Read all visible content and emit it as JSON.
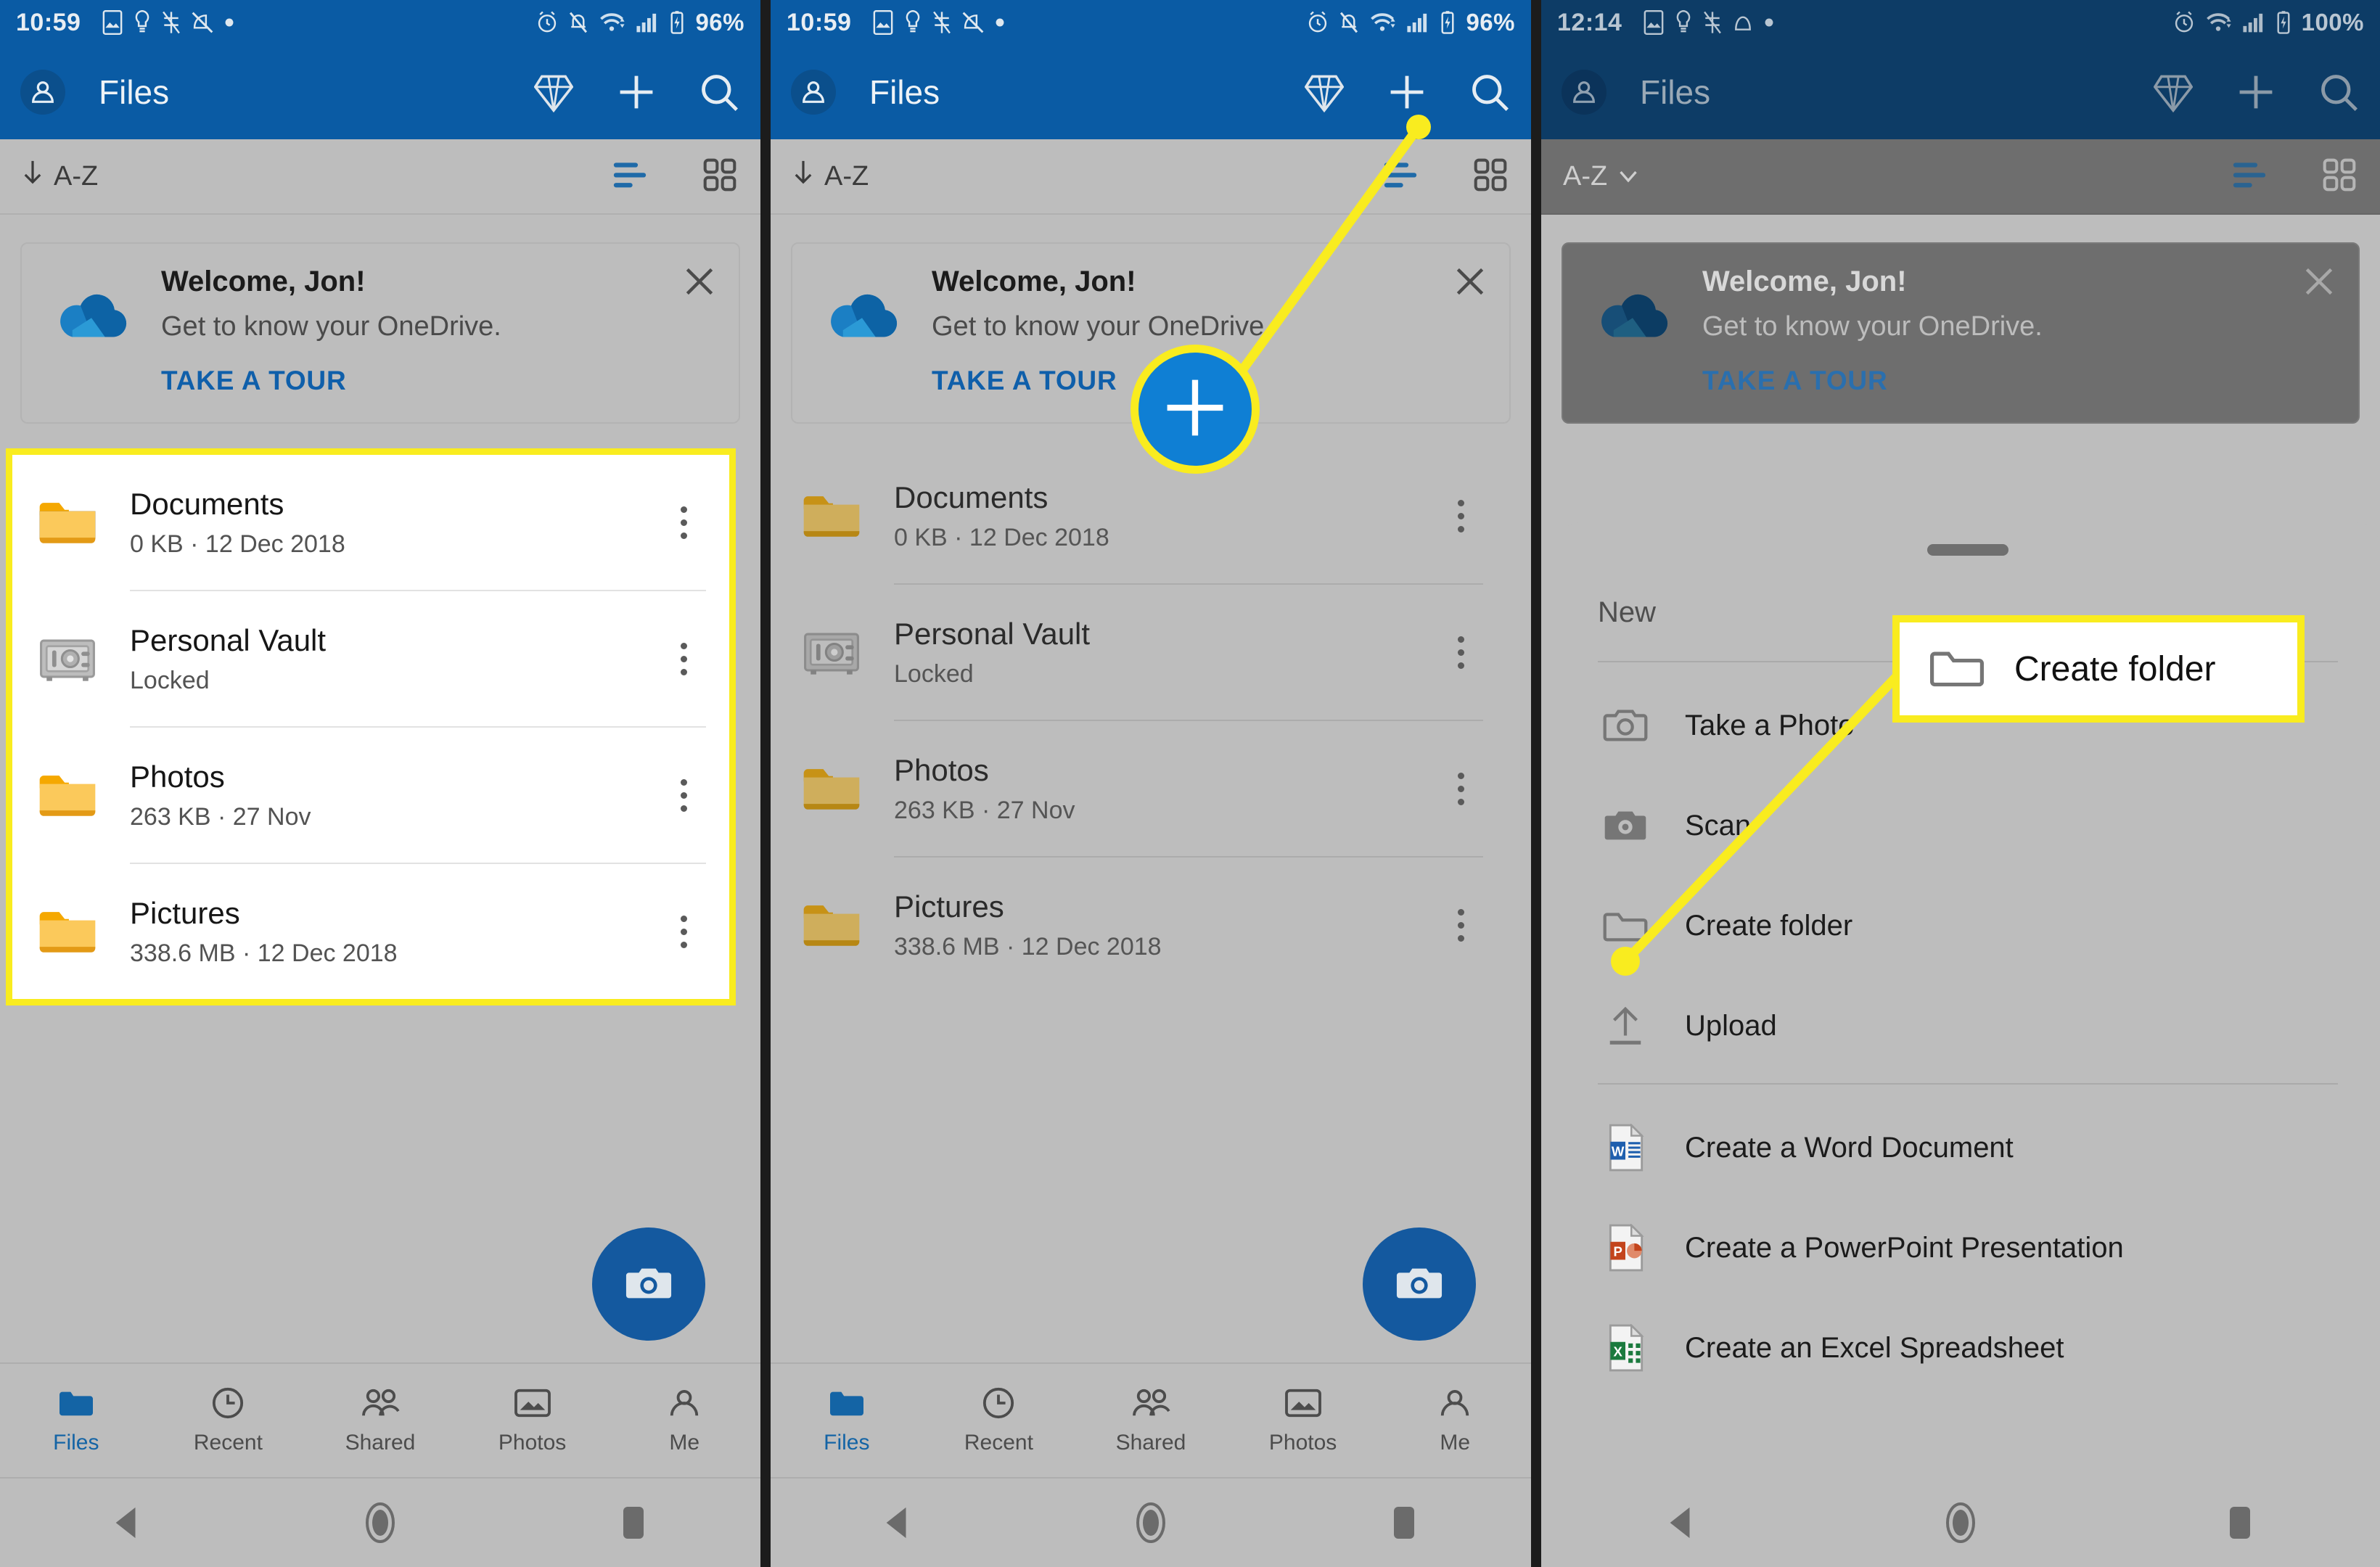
{
  "panels": [
    {
      "status": {
        "time": "10:59",
        "battery": "96%"
      },
      "appbar": {
        "title": "Files",
        "avatar_icon": "account-circle-icon",
        "premium_icon": "diamond-icon",
        "add_icon": "plus-icon",
        "search_icon": "search-icon"
      },
      "sortbar": {
        "sort_label": "A-Z",
        "sort_icon": "arrow-down-icon",
        "list_view_icon": "list-view-icon",
        "grid_view_icon": "grid-view-icon"
      },
      "welcome": {
        "title": "Welcome, Jon!",
        "subtitle": "Get to know your OneDrive.",
        "action": "TAKE A TOUR",
        "logo_icon": "onedrive-cloud-icon",
        "close_icon": "close-icon"
      },
      "files": [
        {
          "name": "Documents",
          "meta": "0 KB · 12 Dec 2018",
          "icon": "folder-icon"
        },
        {
          "name": "Personal Vault",
          "meta": "Locked",
          "icon": "vault-safe-icon"
        },
        {
          "name": "Photos",
          "meta": "263 KB · 27 Nov",
          "icon": "folder-icon"
        },
        {
          "name": "Pictures",
          "meta": "338.6 MB · 12 Dec 2018",
          "icon": "folder-icon"
        }
      ],
      "fab": {
        "icon": "camera-icon"
      },
      "tabs": [
        {
          "label": "Files",
          "icon": "folder-icon",
          "active": true
        },
        {
          "label": "Recent",
          "icon": "clock-icon",
          "active": false
        },
        {
          "label": "Shared",
          "icon": "people-icon",
          "active": false
        },
        {
          "label": "Photos",
          "icon": "photo-icon",
          "active": false
        },
        {
          "label": "Me",
          "icon": "person-icon",
          "active": false
        }
      ],
      "navbar": {
        "back_icon": "back-triangle-icon",
        "home_icon": "home-circle-icon",
        "recents_icon": "recents-square-icon"
      }
    },
    {
      "status": {
        "time": "10:59",
        "battery": "96%"
      },
      "appbar": {
        "title": "Files",
        "avatar_icon": "account-circle-icon",
        "premium_icon": "diamond-icon",
        "add_icon": "plus-icon",
        "search_icon": "search-icon"
      },
      "sortbar": {
        "sort_label": "A-Z",
        "sort_icon": "arrow-down-icon",
        "list_view_icon": "list-view-icon",
        "grid_view_icon": "grid-view-icon"
      },
      "welcome": {
        "title": "Welcome, Jon!",
        "subtitle": "Get to know your OneDrive.",
        "action": "TAKE A TOUR",
        "logo_icon": "onedrive-cloud-icon",
        "close_icon": "close-icon"
      },
      "files": [
        {
          "name": "Documents",
          "meta": "0 KB · 12 Dec 2018",
          "icon": "folder-icon"
        },
        {
          "name": "Personal Vault",
          "meta": "Locked",
          "icon": "vault-safe-icon"
        },
        {
          "name": "Photos",
          "meta": "263 KB · 27 Nov",
          "icon": "folder-icon"
        },
        {
          "name": "Pictures",
          "meta": "338.6 MB · 12 Dec 2018",
          "icon": "folder-icon"
        }
      ],
      "fab": {
        "icon": "camera-icon"
      },
      "tabs": [
        {
          "label": "Files",
          "icon": "folder-icon",
          "active": true
        },
        {
          "label": "Recent",
          "icon": "clock-icon",
          "active": false
        },
        {
          "label": "Shared",
          "icon": "people-icon",
          "active": false
        },
        {
          "label": "Photos",
          "icon": "photo-icon",
          "active": false
        },
        {
          "label": "Me",
          "icon": "person-icon",
          "active": false
        }
      ],
      "navbar": {
        "back_icon": "back-triangle-icon",
        "home_icon": "home-circle-icon",
        "recents_icon": "recents-square-icon"
      }
    },
    {
      "status": {
        "time": "12:14",
        "battery": "100%"
      },
      "appbar": {
        "title": "Files",
        "avatar_icon": "account-circle-icon",
        "premium_icon": "diamond-icon",
        "add_icon": "plus-icon",
        "search_icon": "search-icon"
      },
      "sortbar": {
        "sort_label": "A-Z",
        "sort_icon": "chevron-down-icon",
        "list_view_icon": "list-view-icon",
        "grid_view_icon": "grid-view-icon"
      },
      "welcome": {
        "title": "Welcome, Jon!",
        "subtitle": "Get to know your OneDrive.",
        "action": "TAKE A TOUR",
        "logo_icon": "onedrive-cloud-icon",
        "close_icon": "close-icon"
      },
      "sheet": {
        "title": "New",
        "items": [
          {
            "label": "Take a Photo",
            "icon": "camera-outline-icon"
          },
          {
            "label": "Scan",
            "icon": "scan-camera-icon"
          },
          {
            "label": "Create folder",
            "icon": "folder-outline-icon"
          },
          {
            "label": "Upload",
            "icon": "upload-arrow-icon"
          },
          {
            "label": "Create a Word Document",
            "icon": "word-doc-icon"
          },
          {
            "label": "Create a PowerPoint Presentation",
            "icon": "powerpoint-doc-icon"
          },
          {
            "label": "Create an Excel Spreadsheet",
            "icon": "excel-doc-icon"
          }
        ]
      },
      "navbar": {
        "back_icon": "back-triangle-icon",
        "home_icon": "home-circle-icon",
        "recents_icon": "recents-square-icon"
      }
    }
  ],
  "annotations": {
    "highlight_color": "#f9ec1f",
    "callout_create_folder_label": "Create folder",
    "callout_create_folder_icon": "folder-outline-icon",
    "callout_plus_icon": "plus-icon"
  }
}
